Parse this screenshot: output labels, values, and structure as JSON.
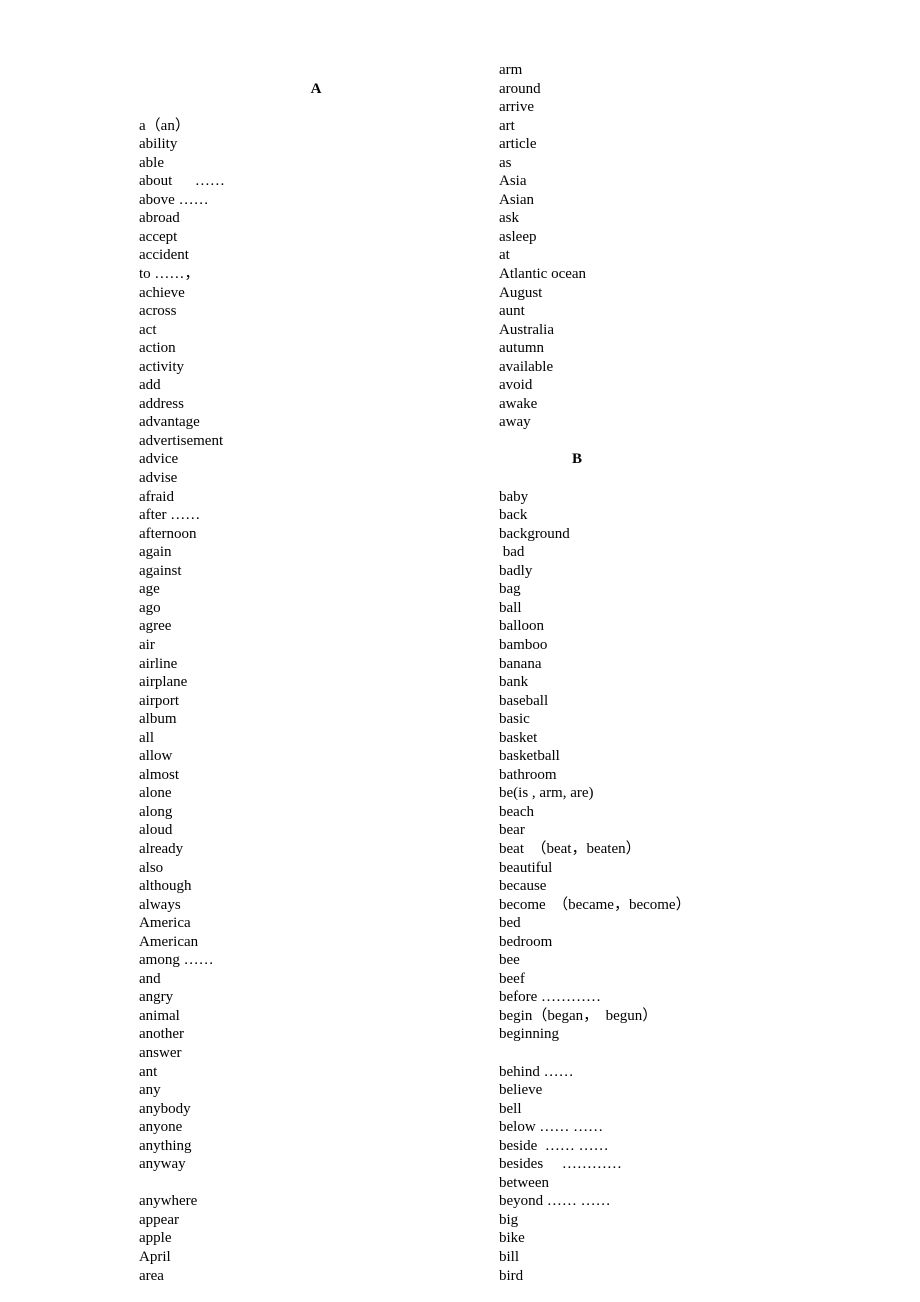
{
  "left_column": {
    "lead_blank": 1,
    "heading": "A",
    "words": [
      "a（an）",
      "ability",
      "able",
      "about      ……",
      "above ……",
      "abroad",
      "accept",
      "accident",
      "to ……，",
      "achieve",
      "across",
      "act",
      "action",
      "activity",
      "add",
      "address",
      "advantage",
      "advertisement",
      "advice",
      "advise",
      "afraid",
      "after ……",
      "afternoon",
      "again",
      "against",
      "age",
      "ago",
      "agree",
      "air",
      "airline",
      "airplane",
      "airport",
      "album",
      "all",
      "allow",
      "almost",
      "alone",
      "along",
      "aloud",
      "already",
      "also",
      "although",
      "always",
      "America",
      "American",
      "among ……",
      "and",
      "angry",
      "animal",
      "another",
      "answer",
      "ant",
      "any",
      "anybody",
      "anyone",
      "anything",
      "anyway",
      "",
      "anywhere",
      "appear",
      "apple",
      "April",
      "area"
    ]
  },
  "right_column": {
    "words_before": [
      "arm",
      "around",
      "arrive",
      "art",
      "article",
      "as",
      "Asia",
      "Asian",
      "ask",
      "asleep",
      "at",
      "Atlantic ocean",
      "August",
      "aunt",
      "Australia",
      "autumn",
      "available",
      "avoid",
      "awake",
      "away"
    ],
    "heading": "B",
    "words": [
      "baby",
      "back",
      "background",
      " bad",
      "badly",
      "bag",
      "ball",
      "balloon",
      "bamboo",
      "banana",
      "bank",
      "baseball",
      "basic",
      "basket",
      "basketball",
      "bathroom",
      "be(is , arm, are)",
      "beach",
      "bear",
      "beat  （beat，beaten）",
      "beautiful",
      "because",
      "become  （became，become）",
      "bed",
      "bedroom",
      "bee",
      "beef",
      "before …………",
      "begin（began，  begun）",
      "beginning",
      "",
      "behind ……",
      "believe",
      "bell",
      "below …… ……",
      "beside  …… ……",
      "besides     …………",
      "between",
      "beyond …… ……",
      "big",
      "bike",
      "bill",
      "bird"
    ]
  }
}
